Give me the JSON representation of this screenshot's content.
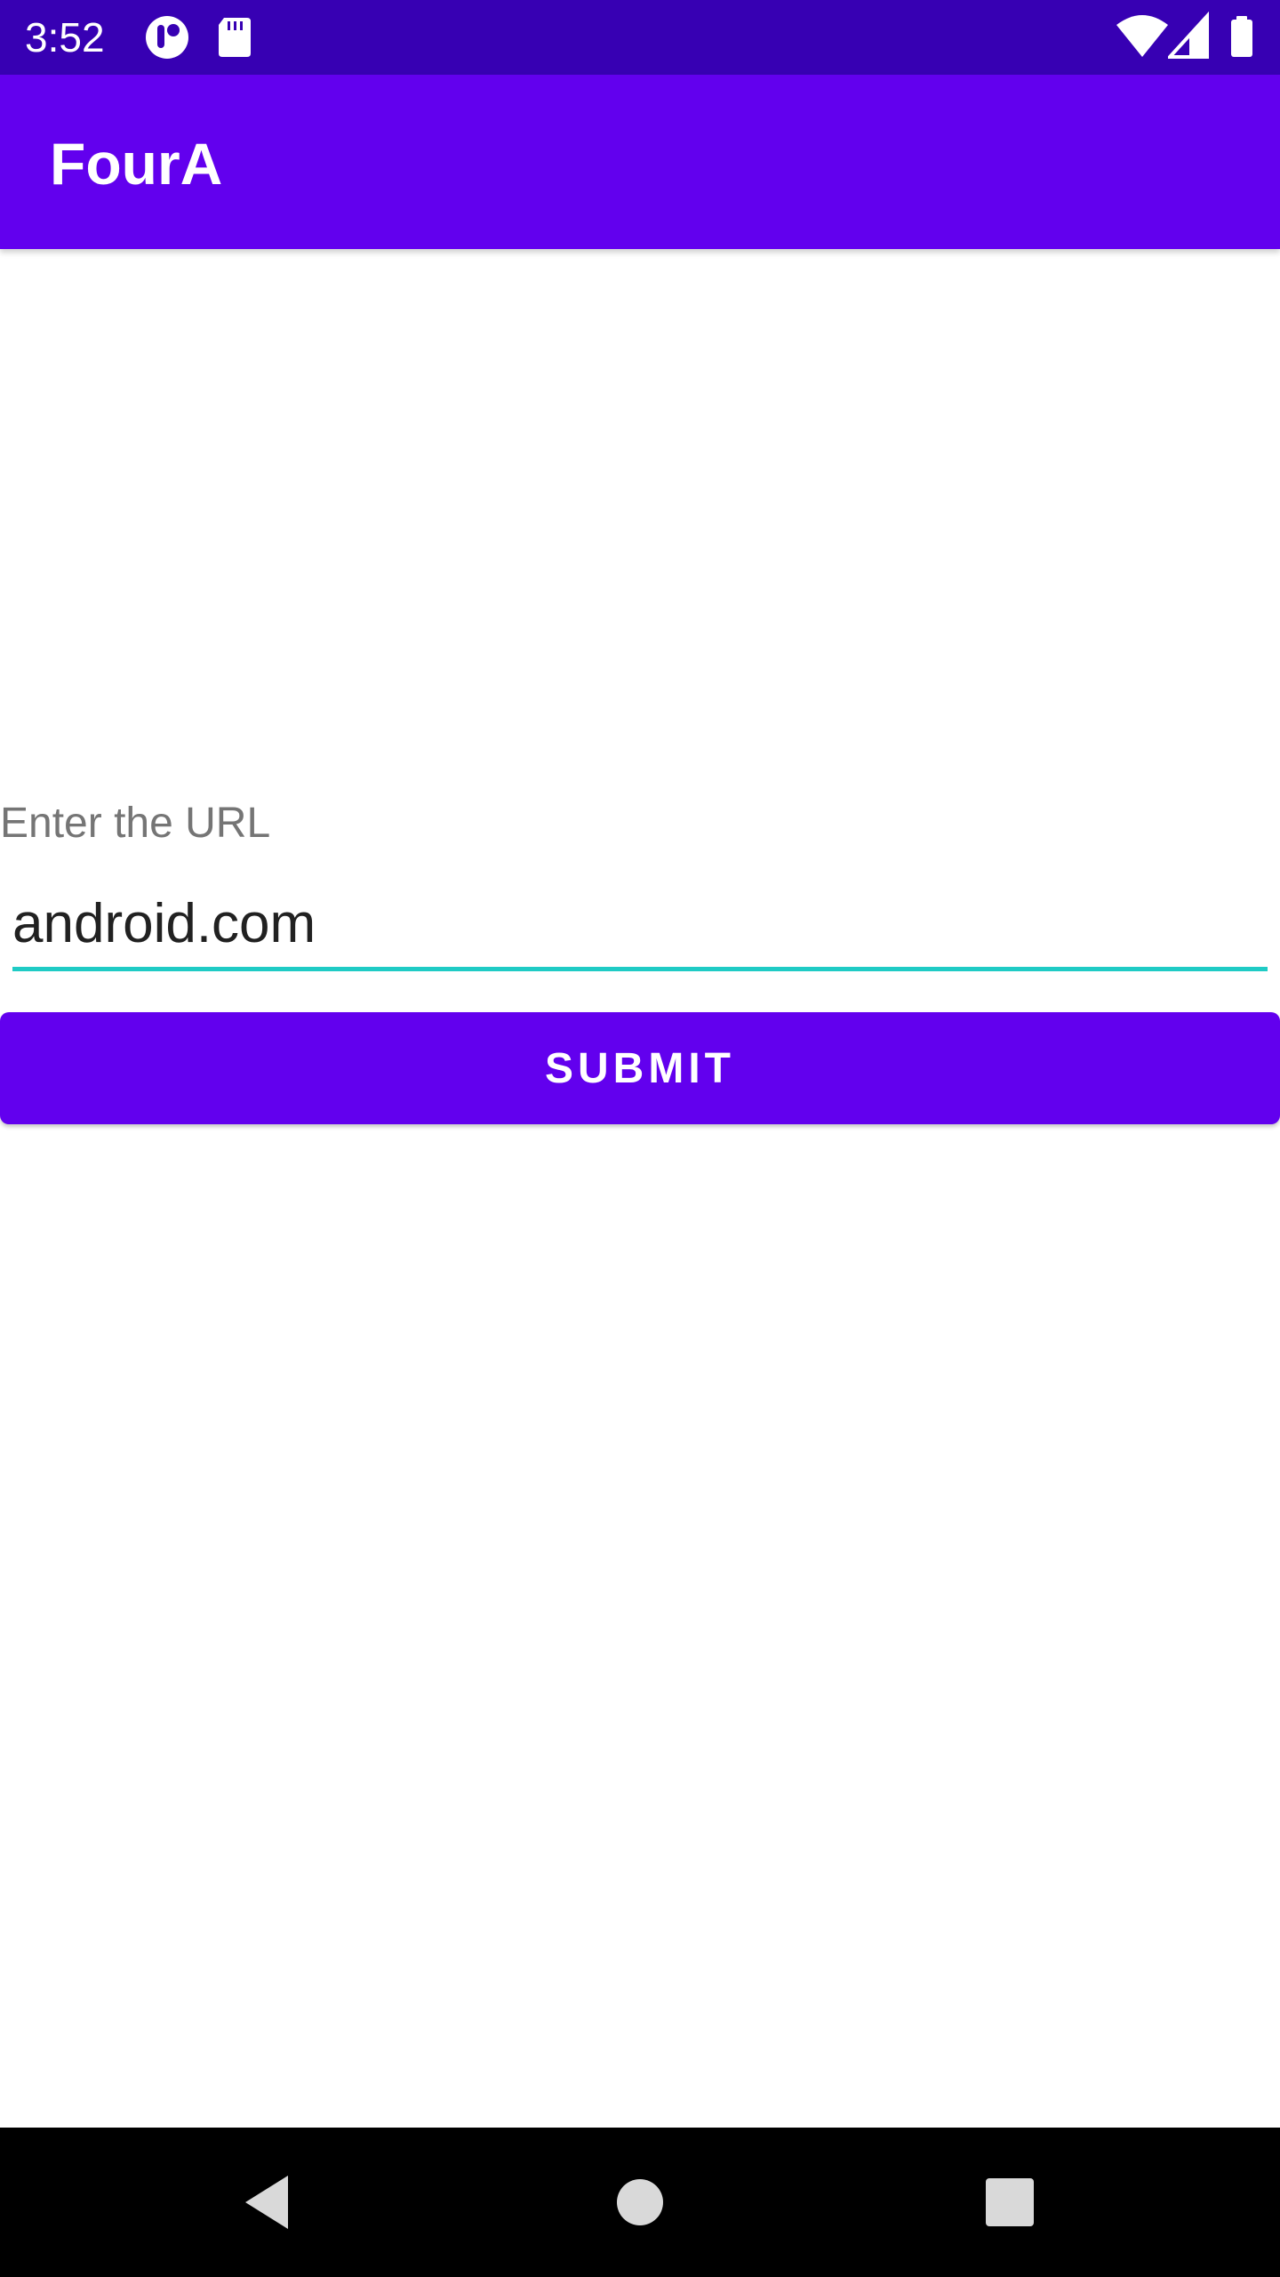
{
  "status_bar": {
    "time": "3:52",
    "left_icons": [
      "app-notification-icon",
      "sd-card-icon"
    ],
    "right_icons": [
      "wifi-icon",
      "cellular-signal-icon",
      "battery-icon"
    ],
    "background": "#3700b3"
  },
  "app_bar": {
    "title": "FourA",
    "background": "#6200ee"
  },
  "form": {
    "label": "Enter the URL",
    "input_value": "android.com",
    "underline_color": "#1fcbc5",
    "submit_label": "SUBMIT",
    "submit_color": "#6200ee"
  },
  "nav_bar": {
    "buttons": [
      "back-icon",
      "home-icon",
      "recents-icon"
    ]
  }
}
